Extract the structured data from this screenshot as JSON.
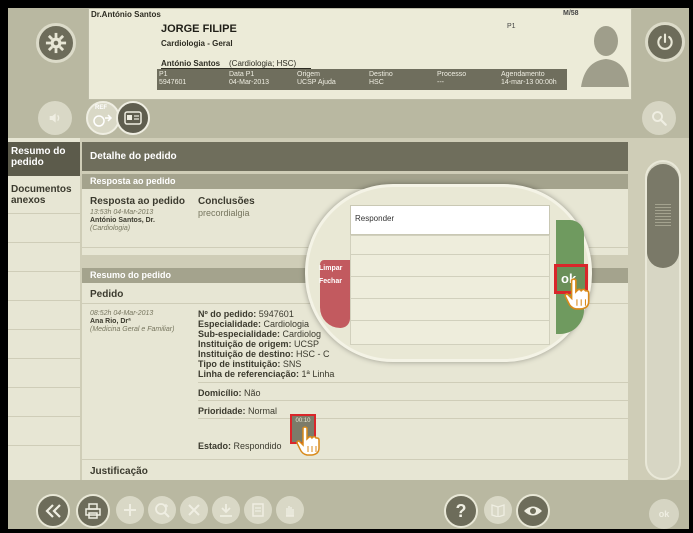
{
  "patient_card": {
    "doctor": "Dr.António Santos",
    "patient_name": "JORGE FILIPE",
    "specialty": "Cardiologia - Geral",
    "author": "António Santos",
    "author_detail": "(Cardiologia; HSC)",
    "tag_p1": "P1",
    "tag_gender_age": "M/58",
    "table": {
      "headers": [
        "P1",
        "Data P1",
        "Origem",
        "Destino",
        "Processo",
        "Agendamento"
      ],
      "values": [
        "5947601",
        "04-Mar-2013",
        "UCSP Ajuda",
        "HSC",
        "---",
        "14-mar-13 00:00h"
      ]
    }
  },
  "top_icons": {
    "gear": "gear-icon",
    "power": "power-icon",
    "search": "search-icon",
    "ref_label": "REF"
  },
  "sidebar": {
    "items": [
      {
        "label": "Resumo do pedido",
        "active": true
      },
      {
        "label": "Documentos anexos",
        "active": false
      }
    ]
  },
  "main": {
    "header": "Detalhe do pedido",
    "resposta_head": "Resposta ao pedido",
    "resposta_title": "Resposta ao pedido",
    "resposta_time": "13:53h 04-Mar-2013",
    "resposta_author": "António Santos, Dr.",
    "resposta_dept": "(Cardiologia)",
    "conclusoes_label": "Conclusões",
    "conclusoes_value": "precordialgia",
    "resumo_head": "Resumo do pedido",
    "pedido_title": "Pedido",
    "pedido_time": "08:52h 04-Mar-2013",
    "pedido_author": "Ana Rio, Drª",
    "pedido_dept": "(Medicina Geral e Familiar)",
    "fields": [
      {
        "label": "Nº do pedido:",
        "value": " 5947601"
      },
      {
        "label": "Especialidade:",
        "value": " Cardiologia"
      },
      {
        "label": "Sub-especialidade:",
        "value": " Cardiolog"
      },
      {
        "label": "Instituição de origem:",
        "value": " UCSP"
      },
      {
        "label": "Instituição de destino:",
        "value": " HSC - C"
      },
      {
        "label": "Tipo de instituição:",
        "value": " SNS"
      },
      {
        "label": "Linha de referenciação:",
        "value": " 1ª Linha"
      }
    ],
    "domicilio": {
      "label": "Domicílio:",
      "value": " Não"
    },
    "prioridade": {
      "label": "Prioridade:",
      "value": " Normal"
    },
    "estado": {
      "label": "Estado:",
      "value": " Respondido"
    },
    "timer": "00:10",
    "justificacao": "Justificação"
  },
  "popup": {
    "input_value": "Responder",
    "limpar": "Limpar",
    "fechar": "Fechar",
    "ok": "ok"
  },
  "toolbar": {
    "ok_label": "ok"
  },
  "colors": {
    "background": "#cfcdb7",
    "dark_header": "#6f6e5c",
    "section_head": "#a4a38d",
    "highlight_red": "#d9262a",
    "ok_green": "#6f9a5f",
    "close_red": "#c25a5f"
  }
}
